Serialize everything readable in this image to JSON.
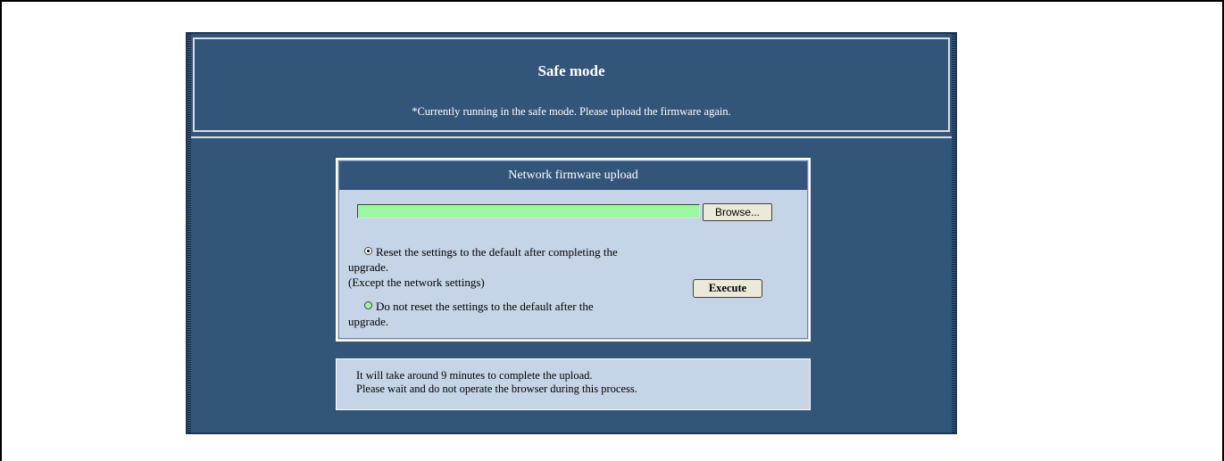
{
  "header": {
    "title": "Safe mode",
    "subtitle": "*Currently running in the safe mode. Please upload the firmware again."
  },
  "upload": {
    "title": "Network firmware upload",
    "file_value": "",
    "browse_label": "Browse...",
    "option_reset": {
      "line1": "Reset the settings to the default after completing the",
      "line2": "upgrade.",
      "line3": "(Except the network settings)",
      "checked": true
    },
    "option_no_reset": {
      "line1": "Do not reset the settings to the default after the",
      "line2": "upgrade.",
      "checked": false
    },
    "execute_label": "Execute"
  },
  "notice": {
    "line1": "It will take around 9 minutes to complete the upload.",
    "line2": "Please wait and do not operate the browser during this process."
  },
  "colors": {
    "panel_bg": "#34557a",
    "box_bg": "#c6d4e8",
    "file_field_bg": "#9cf7a1"
  }
}
